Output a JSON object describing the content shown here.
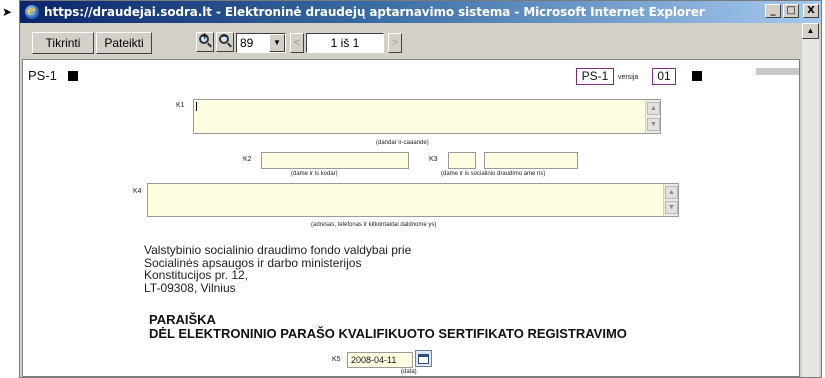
{
  "window": {
    "title": "https://draudejai.sodra.lt - Elektroninė draudejų aptarnavimo sistema - Microsoft Internet Explorer",
    "controls": {
      "minimize": "_",
      "maximize": "□",
      "close": "X"
    }
  },
  "toolbar": {
    "check_label": "Tikrinti",
    "submit_label": "Pateikti",
    "zoom_value": "89",
    "page_indicator": "1 iš 1"
  },
  "form": {
    "form_code": "PS-1",
    "form_code_box": "PS-1",
    "version_label": "versija",
    "version_value": "01",
    "k1_label": "K1",
    "k1_caption": "(dandar ir-caaande)",
    "k2_label": "K2",
    "k2_caption": "(dame ir is kodar)",
    "k3_label": "K3",
    "k3_caption": "(dame ir is socialinio draudimo ame ris)",
    "k4_label": "K4",
    "k4_caption": "(adresas, telefonas ir kitkontaktai daldnome ys)",
    "addressee": {
      "line1": "Valstybinio socialinio draudimo fondo valdybai prie",
      "line2": "Socialinės apsaugos ir darbo ministerijos",
      "line3": "Konstitucijos pr. 12,",
      "line4": "LT-09308, Vilnius"
    },
    "title_line1": "PARAIŠKA",
    "title_line2": "DĖL ELEKTRONINIO PARAŠO KVALIFIKUOTO SERTIFIKATO REGISTRAVIMO",
    "k5_label": "K5",
    "k5_date": "2008-04-11",
    "k5_caption": "(data)"
  },
  "icons": [
    "internet-explorer-icon",
    "zoom-in-icon",
    "zoom-out-icon",
    "calendar-icon",
    "chevron-down-icon",
    "arrow-right-icon"
  ]
}
